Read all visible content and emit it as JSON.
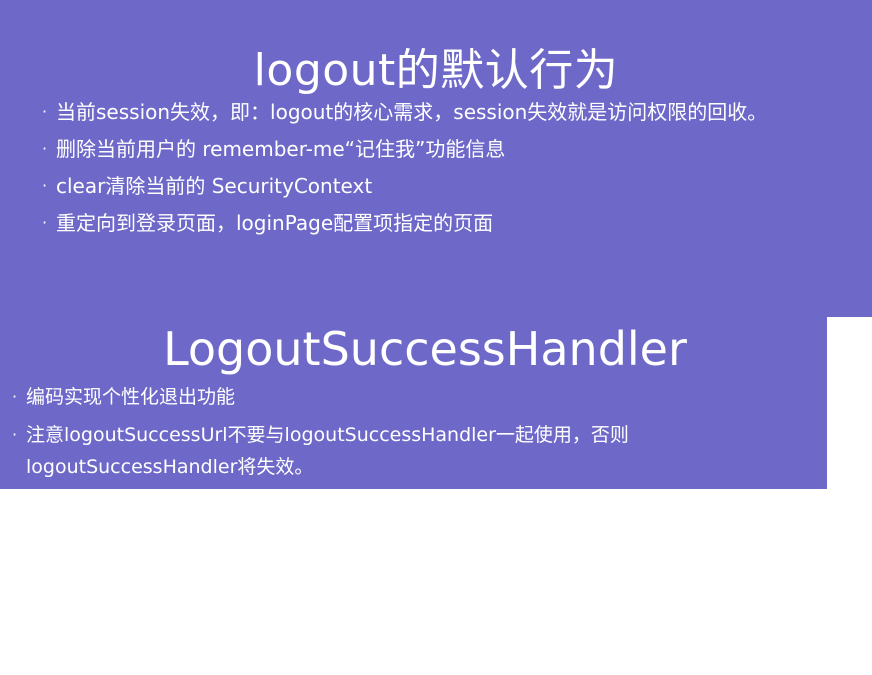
{
  "slide1": {
    "title": "logout的默认行为",
    "bullets": [
      "当前session失效，即：logout的核心需求，session失效就是访问权限的回收。",
      "删除当前用户的 remember-me“记住我”功能信息",
      "clear清除当前的 SecurityContext",
      "重定向到登录页面，loginPage配置项指定的页面"
    ]
  },
  "slide2": {
    "title": "LogoutSuccessHandler",
    "bullets": [
      "编码实现个性化退出功能",
      "注意logoutSuccessUrl不要与logoutSuccessHandler一起使用，否则logoutSuccessHandler将失效。"
    ]
  },
  "colors": {
    "panel": "#6e69c9",
    "text": "#ffffff",
    "page": "#ffffff"
  },
  "bullet_marker": "·"
}
